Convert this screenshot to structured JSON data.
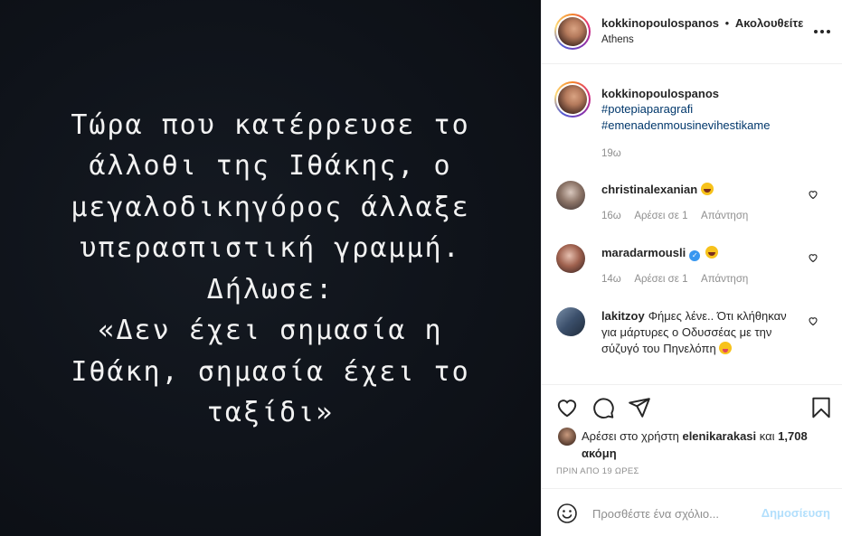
{
  "post": {
    "image_text_lines": [
      "Τώρα που κατέρρευσε το",
      "άλλοθι της Ιθάκης, ο",
      "μεγαλοδικηγόρος άλλαξε",
      "υπερασπιστική γραμμή.",
      "Δήλωσε:",
      "«Δεν έχει σημασία η",
      "Ιθάκη, σημασία έχει το",
      "ταξίδι»"
    ]
  },
  "header": {
    "username": "kokkinopoulospanos",
    "separator": "•",
    "follow_label": "Ακολουθείτε",
    "location": "Athens",
    "more_icon": "more-horizontal-icon"
  },
  "caption": {
    "username": "kokkinopoulospanos",
    "hashtags": [
      "#potepiaparagrafi",
      "#emenadenmousinevihestikame"
    ],
    "time": "19ω"
  },
  "comments": [
    {
      "username": "christinalexanian",
      "text": "",
      "emoji": "laugh",
      "verified": false,
      "time": "16ω",
      "likes": "Αρέσει σε 1",
      "reply": "Απάντηση"
    },
    {
      "username": "maradarmousli",
      "text": "",
      "emoji": "laugh",
      "verified": true,
      "time": "14ω",
      "likes": "Αρέσει σε 1",
      "reply": "Απάντηση"
    },
    {
      "username": "lakitzoy",
      "text": "Φήμες λένε.. Ότι κλήθηκαν για μάρτυρες ο Οδυσσέας με την σύζυγό του Πηνελόπη",
      "emoji": "tongue",
      "verified": false
    }
  ],
  "actions": {
    "likes_prefix": "Αρέσει στο χρήστη",
    "likes_user": "elenikarakasi",
    "likes_and": "και",
    "likes_count": "1,708 ακόμη",
    "post_time": "ΠΡΙΝ ΑΠΟ 19 ΩΡΕΣ"
  },
  "add_comment": {
    "placeholder": "Προσθέστε ένα σχόλιο...",
    "publish_label": "Δημοσίευση"
  },
  "colors": {
    "link": "#00376b",
    "muted": "#8e8e8e",
    "publish_disabled": "#b2dffc",
    "image_bg": "#0f131a"
  }
}
